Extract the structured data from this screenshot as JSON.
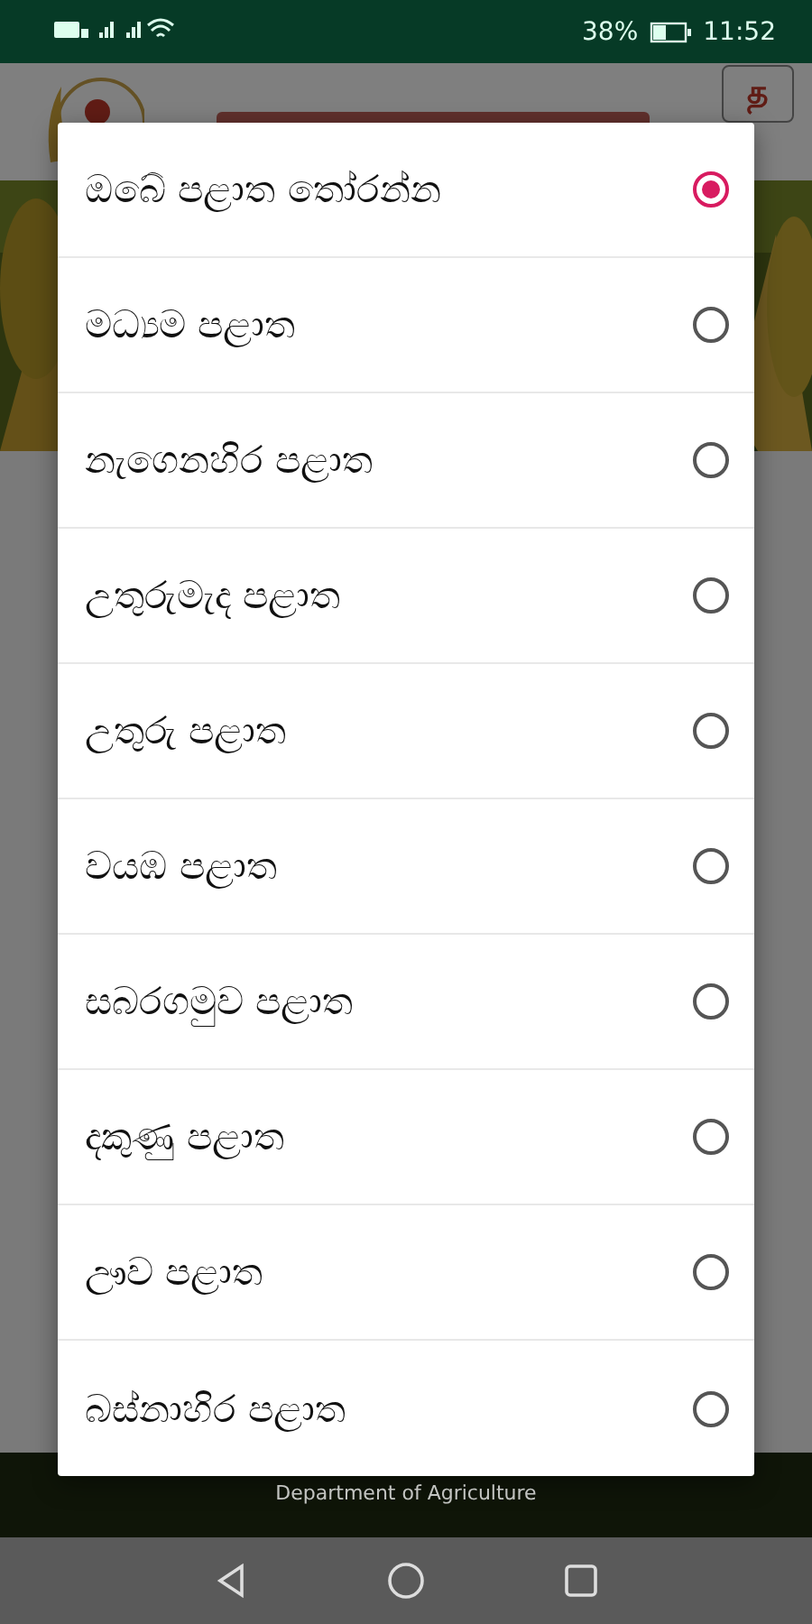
{
  "status_bar": {
    "battery": "38%",
    "time": "11:52"
  },
  "header": {
    "language_button": "த"
  },
  "footer": {
    "title": "Department of Agriculture"
  },
  "dialog": {
    "options": [
      {
        "label": "ඔබේ පළාත තෝරන්න",
        "selected": true
      },
      {
        "label": "මධ්‍යම පළාත",
        "selected": false
      },
      {
        "label": "නැගෙනහිර පළාත",
        "selected": false
      },
      {
        "label": "උතුරුමැද පළාත",
        "selected": false
      },
      {
        "label": "උතුරු පළාත",
        "selected": false
      },
      {
        "label": "වයඹ පළාත",
        "selected": false
      },
      {
        "label": "සබරගමුව පළාත",
        "selected": false
      },
      {
        "label": "දකුණු පළාත",
        "selected": false
      },
      {
        "label": "ඌව පළාත",
        "selected": false
      },
      {
        "label": "බස්නාහිර පළාත",
        "selected": false
      }
    ]
  }
}
